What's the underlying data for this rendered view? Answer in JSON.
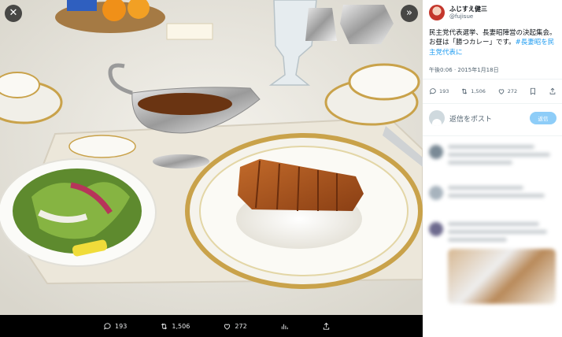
{
  "viewer": {
    "close_label": "✕",
    "expand_label": "»",
    "bottom_actions": [
      {
        "icon": "reply-icon",
        "count": "193"
      },
      {
        "icon": "retweet-icon",
        "count": "1,506"
      },
      {
        "icon": "like-icon",
        "count": "272"
      },
      {
        "icon": "views-icon",
        "count": ""
      },
      {
        "icon": "share-icon",
        "count": ""
      }
    ]
  },
  "tweet": {
    "author": {
      "display_name": "ふじすえ健三",
      "handle": "@fujisue"
    },
    "text_main": "民主党代表選挙、長妻昭陣営の決起集会。お昼は「勝つカレー」です。",
    "hashtag": "#長妻昭を民主党代表に",
    "timestamp": "午後0:06 · 2015年1月18日",
    "actions": [
      {
        "icon": "reply-icon",
        "count": "193"
      },
      {
        "icon": "retweet-icon",
        "count": "1,506"
      },
      {
        "icon": "like-icon",
        "count": "272"
      },
      {
        "icon": "bookmark-icon",
        "count": ""
      },
      {
        "icon": "share-icon",
        "count": ""
      }
    ]
  },
  "reply": {
    "placeholder": "返信をポスト",
    "button_label": "返信"
  },
  "colors": {
    "accent": "#1d9bf0",
    "reply_button": "#8ecdf8",
    "panel_bg": "#ffffff",
    "viewer_bg": "#000000"
  }
}
